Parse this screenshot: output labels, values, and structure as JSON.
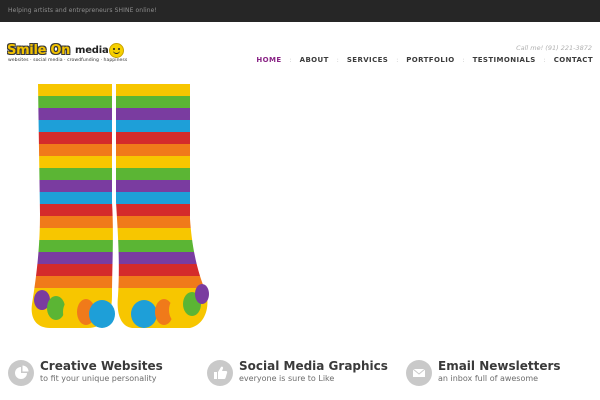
{
  "topbar": {
    "tagline": "Helping artists and entrepreneurs SHINE online!"
  },
  "logo": {
    "word_main": "Smile On",
    "word_media": "media",
    "subtitle": "websites · social media · crowdfunding · happiness"
  },
  "header": {
    "call_text": "Call me! (91) 221-3872"
  },
  "nav": {
    "items": [
      {
        "label": "HOME",
        "active": true
      },
      {
        "label": "ABOUT",
        "active": false
      },
      {
        "label": "SERVICES",
        "active": false
      },
      {
        "label": "PORTFOLIO",
        "active": false
      },
      {
        "label": "TESTIMONIALS",
        "active": false
      },
      {
        "label": "CONTACT",
        "active": false
      }
    ],
    "separator": ":"
  },
  "features": [
    {
      "title": "Creative Websites",
      "desc": "to fit your unique personality",
      "icon": "pie-chart-icon"
    },
    {
      "title": "Social Media Graphics",
      "desc": "everyone is sure to Like",
      "icon": "thumbs-up-icon"
    },
    {
      "title": "Email Newsletters",
      "desc": "an inbox full of awesome",
      "icon": "envelope-icon"
    }
  ],
  "colors": {
    "accent": "#8a2586",
    "topbar": "#262626",
    "icon_circle": "#c9c9c9"
  }
}
